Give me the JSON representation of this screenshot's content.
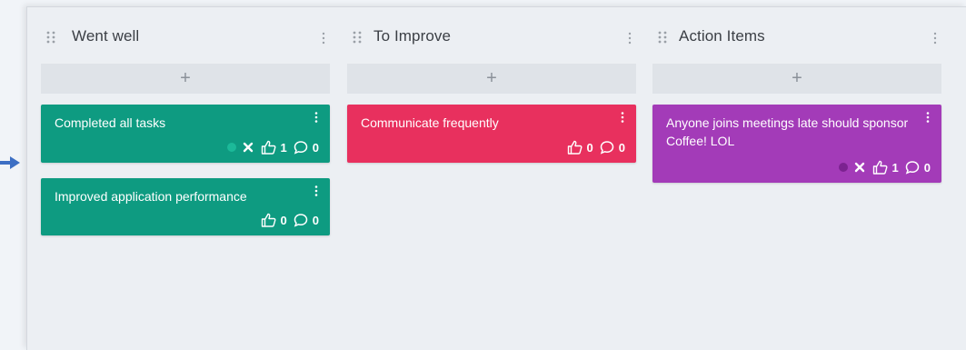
{
  "colors": {
    "went_well": "#0e9b81",
    "to_improve": "#e8305e",
    "action_items": "#a33bb8",
    "went_well_dot": "#1cb999",
    "action_items_dot": "#7b2290"
  },
  "columns": [
    {
      "title": "Went well",
      "add_label": "+",
      "cards": [
        {
          "text": "Completed all tasks",
          "likes": "1",
          "comments": "0",
          "has_status": true
        },
        {
          "text": "Improved application performance",
          "likes": "0",
          "comments": "0",
          "has_status": false
        }
      ]
    },
    {
      "title": "To Improve",
      "add_label": "+",
      "cards": [
        {
          "text": "Communicate frequently",
          "likes": "0",
          "comments": "0",
          "has_status": false
        }
      ]
    },
    {
      "title": "Action Items",
      "add_label": "+",
      "cards": [
        {
          "text": "Anyone joins meetings late should sponsor Coffee! LOL",
          "likes": "1",
          "comments": "0",
          "has_status": true
        }
      ]
    }
  ],
  "icons": {
    "column_drag": "drag-handle-icon",
    "column_menu": "vertical-dots-icon",
    "card_menu": "vertical-dots-icon",
    "like": "thumbs-up-icon",
    "comment": "speech-bubble-icon",
    "remove": "close-icon",
    "status": "status-dot-icon",
    "pointer": "arrow-right-icon"
  }
}
